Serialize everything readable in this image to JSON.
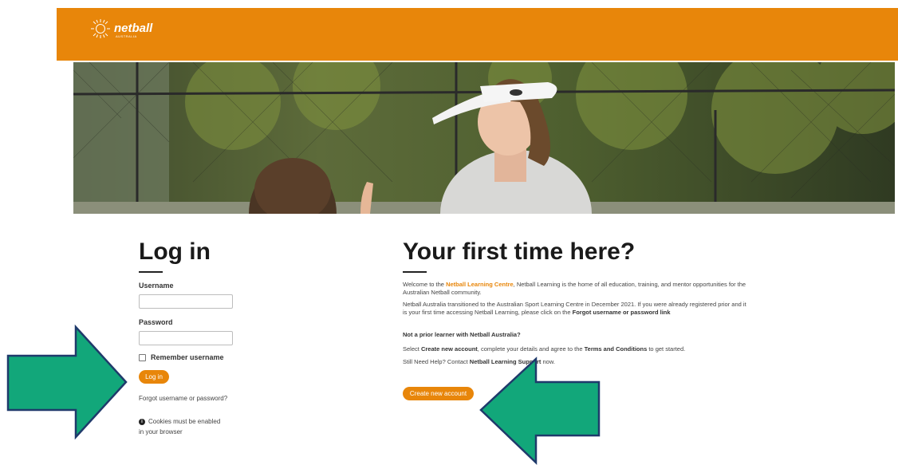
{
  "header": {
    "logo_text": "netball",
    "logo_sub": "AUSTRALIA",
    "brand_color": "#e8860a"
  },
  "hero": {
    "icon": "hero-photo-coach-high-five"
  },
  "login": {
    "title": "Log in",
    "username_label": "Username",
    "username_value": "",
    "password_label": "Password",
    "password_value": "",
    "remember_label": "Remember username",
    "login_button": "Log in",
    "forgot_link": "Forgot username or password?",
    "cookies_line1": "Cookies must be enabled",
    "cookies_line2": "in your browser",
    "info_icon": "info-icon"
  },
  "signup": {
    "title": "Your first time here?",
    "p1_a": "Welcome to the ",
    "p1_link": "Netball Learning Centre",
    "p1_b": ", Netball Learning is the home of all education, training, and mentor opportunities for the",
    "p1_c": "Australian Netball community.",
    "p2_a": "Netball Australia transitioned to the Australian Sport Learning Centre in December 2021. If you were already registered prior and it",
    "p2_b": "is your first time accessing Netball Learning, please click on the ",
    "p2_bold": " Forgot username or password link",
    "subheading": "Not a prior learner with Netball Australia?",
    "p3_a": "Select ",
    "p3_bold1": "Create new account",
    "p3_b": ", complete your details and agree to the ",
    "p3_bold2": "Terms and Conditions",
    "p3_c": " to get started.",
    "p4_a": "Still Need Help? Contact ",
    "p4_bold": "Netball Learning Support",
    "p4_b": " now.",
    "create_button": "Create new account"
  },
  "annotations": {
    "arrow_color": "#12a77a",
    "arrow_border": "#1f3a6b"
  }
}
